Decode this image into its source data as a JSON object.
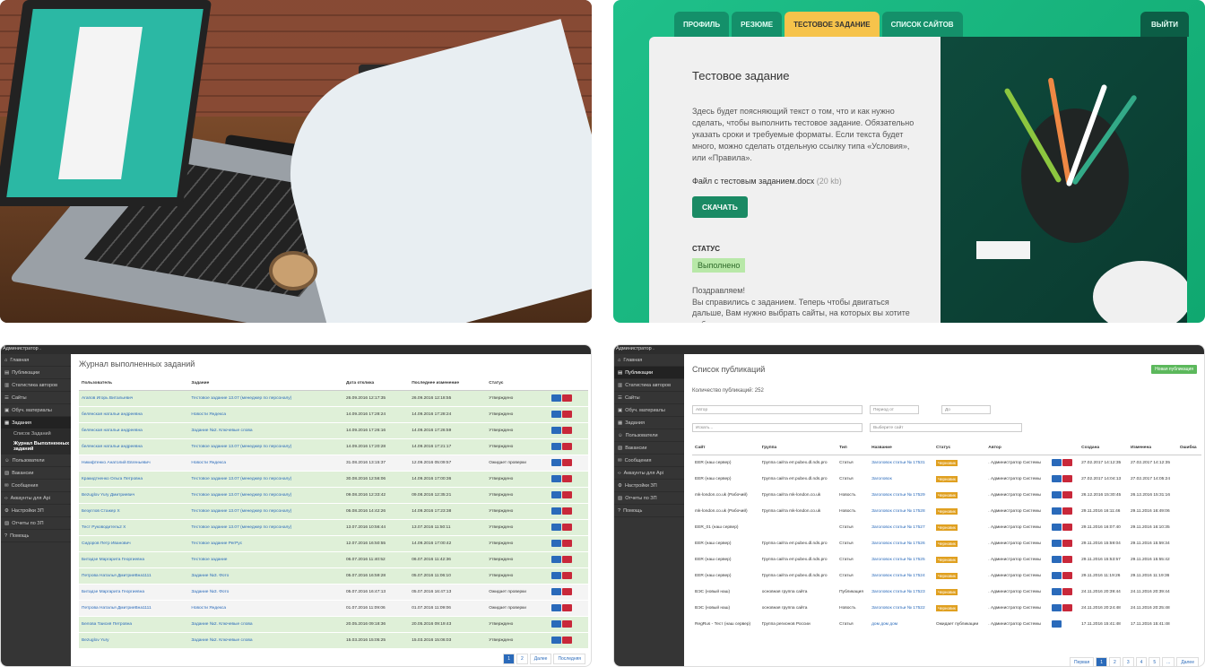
{
  "colors": {
    "accent_green": "#1a8a64",
    "active_tab": "#f6c34b",
    "status_done": "#b8e8a8",
    "sidebar": "#353535",
    "link": "#2a6aba",
    "danger": "#c8283a"
  },
  "assignment_panel": {
    "tabs": [
      "ПРОФИЛЬ",
      "РЕЗЮМЕ",
      "ТЕСТОВОЕ ЗАДАНИЕ",
      "СПИСОК САЙТОВ"
    ],
    "exit_label": "ВЫЙТИ",
    "title": "Тестовое задание",
    "description": "Здесь будет поясняющий текст о том, что и как нужно сделать, чтобы выполнить тестовое задание. Обязательно указать сроки и требуемые форматы. Если текста будет много, можно сделать отдельную ссылку типа «Условия», или «Правила».",
    "file_name": "Файл с тестовым заданием.docx",
    "file_size": "(20 kb)",
    "download_label": "СКАЧАТЬ",
    "status_label": "СТАТУС",
    "status_value": "Выполнено",
    "congrats": "Поздравляем!\nВы справились с заданием. Теперь чтобы двигаться дальше, Вам нужно выбрать сайты, на которых вы хотите работать."
  },
  "admin_journal": {
    "user": "Администратор .",
    "sidebar": [
      "Главная",
      "Публикации",
      "Статистика авторов",
      "Сайты",
      "Обуч. материалы",
      "Задания",
      "Список Заданий",
      "Журнал Выполненных заданий",
      "Пользователи",
      "Вакансии",
      "Сообщения",
      "Аккаунты для Api",
      "Настройки ЗП",
      "Отчеты по ЗП",
      "Помощь"
    ],
    "title": "Журнал выполненных заданий",
    "columns": [
      "Пользователь",
      "Задание",
      "Дата отклика",
      "Последнее изменение",
      "Статус"
    ],
    "rows": [
      [
        "Агапов Игорь Витальевич",
        "Тестовое задание 13.07 (менеджер по персоналу)",
        "26.09.2016 12:17:35",
        "26.09.2016 12:18:55",
        "Утверждено",
        "ok"
      ],
      [
        "белянская натальи андреевна",
        "Новости Яндекса",
        "14.09.2016 17:28:24",
        "14.09.2016 17:28:24",
        "Утверждено",
        "ok"
      ],
      [
        "белянская натальи андреевна",
        "Задание №2. Ключевые слова",
        "14.09.2016 17:26:16",
        "14.09.2016 17:26:59",
        "Утверждено",
        "ok"
      ],
      [
        "белянская натальи андреевна",
        "Тестовое задание 13.07 (менеджер по персоналу)",
        "14.09.2016 17:20:28",
        "14.09.2016 17:21:17",
        "Утверждено",
        "ok"
      ],
      [
        "Никифтенко Анатолий Евгеньевич",
        "Новости Яндекса",
        "31.08.2016 13:15:37",
        "12.09.2016 05:09:57",
        "Ожидает проверки",
        "wait"
      ],
      [
        "Кракидтненко Ольга Петровна",
        "Тестовое задание 13.07 (менеджер по персоналу)",
        "30.08.2016 12:56:06",
        "14.09.2016 17:00:36",
        "Утверждено",
        "ok"
      ],
      [
        "Bezuglov Yury Дмитриевич",
        "Тестовое задание 13.07 (менеджер по персоналу)",
        "09.08.2016 12:33:42",
        "09.08.2016 12:35:21",
        "Утверждено",
        "ok"
      ],
      [
        "Безуглов Стажер Х",
        "Тестовое задание 13.07 (менеджер по персоналу)",
        "05.08.2016 14:42:26",
        "14.09.2016 17:23:38",
        "Утверждено",
        "ok"
      ],
      [
        "Тест Руководитель2 Х",
        "Тестовое задание 13.07 (менеджер по персоналу)",
        "13.07.2016 10:56:44",
        "13.07.2016 11:50:11",
        "Утверждено",
        "ok"
      ],
      [
        "Сидоров Петр Иванович",
        "Тестовое задание РегРус",
        "12.07.2016 16:50:55",
        "14.09.2016 17:00:42",
        "Утверждено",
        "ok"
      ],
      [
        "Битадзе Маргарита Георгиевна",
        "Тестовое задание",
        "06.07.2016 11:40:52",
        "06.07.2016 11:42:36",
        "Утверждено",
        "ok"
      ],
      [
        "Петрова Наталья ДмитриеВна1111",
        "Задание №3. Фото",
        "05.07.2016 16:59:28",
        "05.07.2016 11:06:10",
        "Утверждено",
        "ok"
      ],
      [
        "Битадзе Маргарита Георгиевна",
        "Задание №3. Фото",
        "05.07.2016 16:47:13",
        "05.07.2016 16:47:13",
        "Ожидает проверки",
        "wait"
      ],
      [
        "Петрова Наталья ДмитриеВна1111",
        "Новости Яндекса",
        "01.07.2016 11:09:06",
        "01.07.2016 11:09:06",
        "Ожидает проверки",
        "wait"
      ],
      [
        "Белова Таисия Петровна",
        "Задание №2. Ключевые слова",
        "20.05.2016 09:18:36",
        "20.05.2016 09:19:43",
        "Утверждено",
        "ok"
      ],
      [
        "Bezuglov Yury",
        "Задание №2. Ключевые слова",
        "15.03.2016 15:05:25",
        "15.03.2016 15:06:03",
        "Утверждено",
        "ok"
      ]
    ],
    "pager": [
      "1",
      "2",
      "Далее",
      "Последняя"
    ]
  },
  "admin_publications": {
    "user": "Администратор .",
    "sidebar": [
      "Главная",
      "Публикации",
      "Статистика авторов",
      "Сайты",
      "Обуч. материалы",
      "Задания",
      "Пользователи",
      "Вакансии",
      "Сообщения",
      "Аккаунты для Api",
      "Настройки ЗП",
      "Отчеты по ЗП",
      "Помощь"
    ],
    "title": "Список публикаций",
    "new_button": "Новая публикация",
    "count": "Количество публикаций: 252",
    "filters": {
      "author": "Автор",
      "period_from": "Период от",
      "to": "До",
      "search": "Искать...",
      "site": "Выберите сайт"
    },
    "columns": [
      "Сайт",
      "Группа",
      "Тип",
      "Название",
      "Статус",
      "Автор",
      "",
      "Создана",
      "Изменена",
      "Ошибка"
    ],
    "rows": [
      [
        "EER (наш сервер)",
        "Группа сайта err.pubex.dl.nds.pro",
        "Статья",
        "Заголовок статьи № 17531",
        "Черновик",
        ". Администратор Системы",
        "27.02.2017 14:12:35",
        "27.02.2017 14:12:35"
      ],
      [
        "EER (наш сервер)",
        "Группа сайта err.pubex.dl.nds.pro",
        "Статья",
        "Заголовок",
        "Черновик",
        ". Администратор Системы",
        "27.02.2017 14:04:13",
        "27.02.2017 14:05:24"
      ],
      [
        "mk-london.co.uk (Рабочий)",
        "Группа сайта mk-london.co.uk",
        "Новость",
        "Заголовок статьи № 17529",
        "Черновик",
        ". Администратор Системы",
        "26.12.2016 15:30:45",
        "26.12.2016 15:31:16"
      ],
      [
        "mk-london.co.uk (Рабочий)",
        "Группа сайта mk-london.co.uk",
        "Новость",
        "Заголовок статьи № 17528",
        "Черновик",
        ". Администратор Системы",
        "29.11.2016 16:11:46",
        "29.11.2016 16:49:06"
      ],
      [
        "EER_01 (наш сервер)",
        "",
        "Статья",
        "Заголовок статьи № 17527",
        "Черновик",
        ". Администратор Системы",
        "29.11.2016 16:07:40",
        "29.11.2016 16:10:35"
      ],
      [
        "EER (наш сервер)",
        "Группа сайта err.pubex.dl.nds.pro",
        "Статья",
        "Заголовок статьи № 17526",
        "Черновик",
        ". Администратор Системы",
        "29.11.2016 15:59:04",
        "29.11.2016 15:59:34"
      ],
      [
        "EER (наш сервер)",
        "Группа сайта err.pubex.dl.nds.pro",
        "Статья",
        "Заголовок статьи № 17525",
        "Черновик",
        ". Администратор Системы",
        "29.11.2016 15:53:57",
        "29.11.2016 15:55:42"
      ],
      [
        "EER (наш сервер)",
        "Группа сайта err.pubex.dl.nds.pro",
        "Статья",
        "Заголовок статьи № 17524",
        "Черновик",
        ". Администратор Системы",
        "29.11.2016 11:19:26",
        "29.11.2016 11:19:36"
      ],
      [
        "ВЭС (новый наш)",
        "основная группа сайта",
        "Публикация",
        "Заголовок статьи № 17523",
        "Черновик",
        ". Администратор Системы",
        "24.11.2016 20:39:44",
        "24.11.2016 20:39:44"
      ],
      [
        "ВЭС (новый наш)",
        "основная группа сайта",
        "Новость",
        "Заголовок статьи № 17522",
        "Черновик",
        ". Администратор Системы",
        "24.11.2016 20:24:48",
        "24.11.2016 20:25:48"
      ],
      [
        "RegRus - Тест (наш сервер)",
        "Группа регионов России",
        "Статья",
        "дом дом дом",
        "Ожидает публикации",
        ". Администратор Системы",
        "17.11.2016 15:41:48",
        "17.11.2016 15:41:48"
      ]
    ],
    "pager": [
      "Первая",
      "1",
      "2",
      "3",
      "4",
      "5",
      "...",
      "Далее"
    ]
  }
}
